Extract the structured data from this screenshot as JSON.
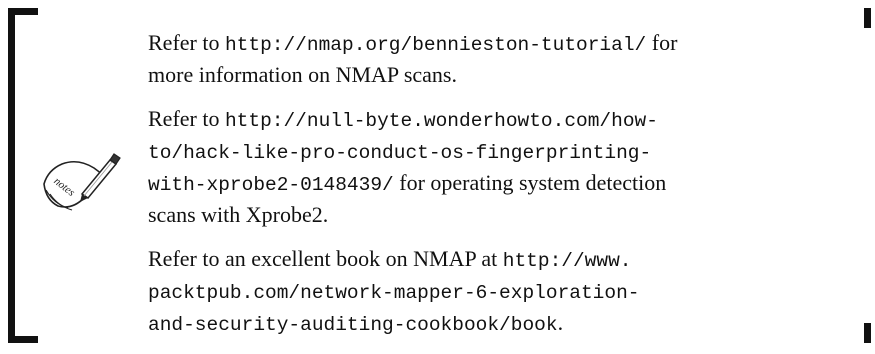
{
  "notes_icon": {
    "name": "notes-pen-icon",
    "label": "notes"
  },
  "paragraphs": [
    {
      "lines": [
        [
          {
            "text": "Refer to ",
            "mono": false
          },
          {
            "text": "http://nmap.org/bennieston-tutorial/",
            "mono": true
          },
          {
            "text": " for",
            "mono": false
          }
        ],
        [
          {
            "text": "more information on NMAP scans.",
            "mono": false
          }
        ]
      ]
    },
    {
      "lines": [
        [
          {
            "text": "Refer to ",
            "mono": false
          },
          {
            "text": "http://null-byte.wonderhowto.com/how-",
            "mono": true
          }
        ],
        [
          {
            "text": "to/hack-like-pro-conduct-os-fingerprinting-",
            "mono": true
          }
        ],
        [
          {
            "text": "with-xprobe2-0148439/",
            "mono": true
          },
          {
            "text": " for operating system detection",
            "mono": false
          }
        ],
        [
          {
            "text": "scans with Xprobe2.",
            "mono": false
          }
        ]
      ]
    },
    {
      "lines": [
        [
          {
            "text": "Refer to an excellent book on NMAP at ",
            "mono": false
          },
          {
            "text": "http://www.",
            "mono": true
          }
        ],
        [
          {
            "text": "packtpub.com/network-mapper-6-exploration-",
            "mono": true
          }
        ],
        [
          {
            "text": "and-security-auditing-cookbook/book",
            "mono": true
          },
          {
            "text": ".",
            "mono": false
          }
        ]
      ]
    }
  ]
}
